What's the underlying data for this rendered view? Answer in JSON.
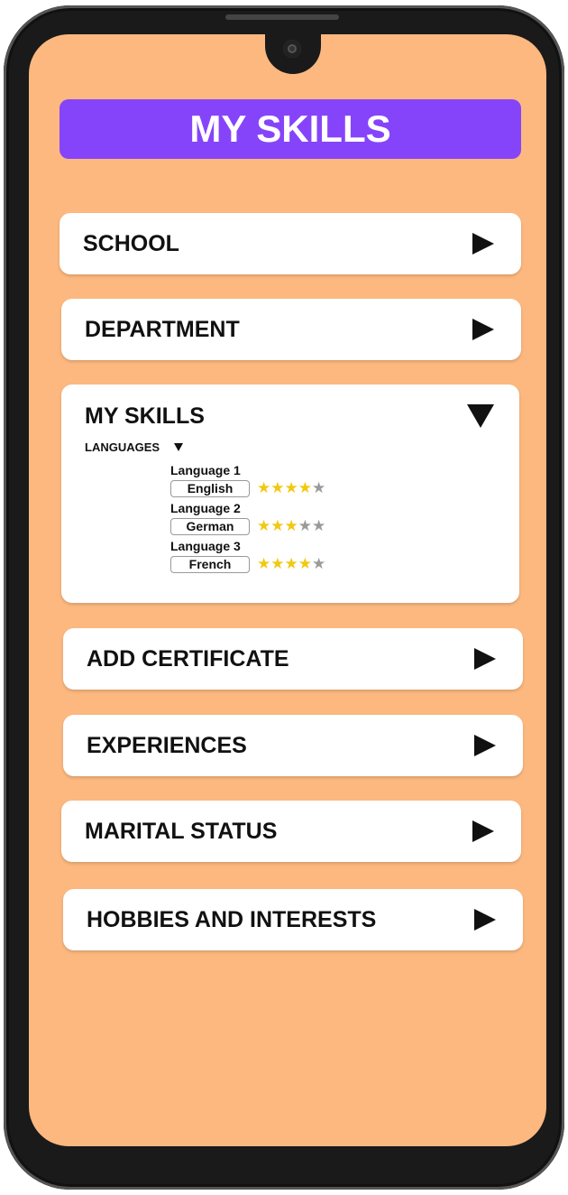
{
  "title": "MY SKILLS",
  "menu": [
    {
      "label": "SCHOOL"
    },
    {
      "label": "DEPARTMENT"
    }
  ],
  "skills_section": {
    "label": "MY SKILLS",
    "languages_label": "LANGUAGES",
    "languages": [
      {
        "title": "Language 1",
        "value": "English",
        "rating": 4,
        "max": 5
      },
      {
        "title": "Language 2",
        "value": "German",
        "rating": 3,
        "max": 5
      },
      {
        "title": "Language 3",
        "value": "French",
        "rating": 4,
        "max": 5
      }
    ]
  },
  "menu_after": [
    {
      "label": "ADD CERTIFICATE"
    },
    {
      "label": "EXPERIENCES"
    },
    {
      "label": "MARITAL STATUS"
    },
    {
      "label": "HOBBIES AND INTERESTS"
    }
  ],
  "colors": {
    "screen_bg": "#fcb87f",
    "title_bg": "#8644fa",
    "star_on": "#f2c811",
    "star_off": "#9a9a9a"
  }
}
